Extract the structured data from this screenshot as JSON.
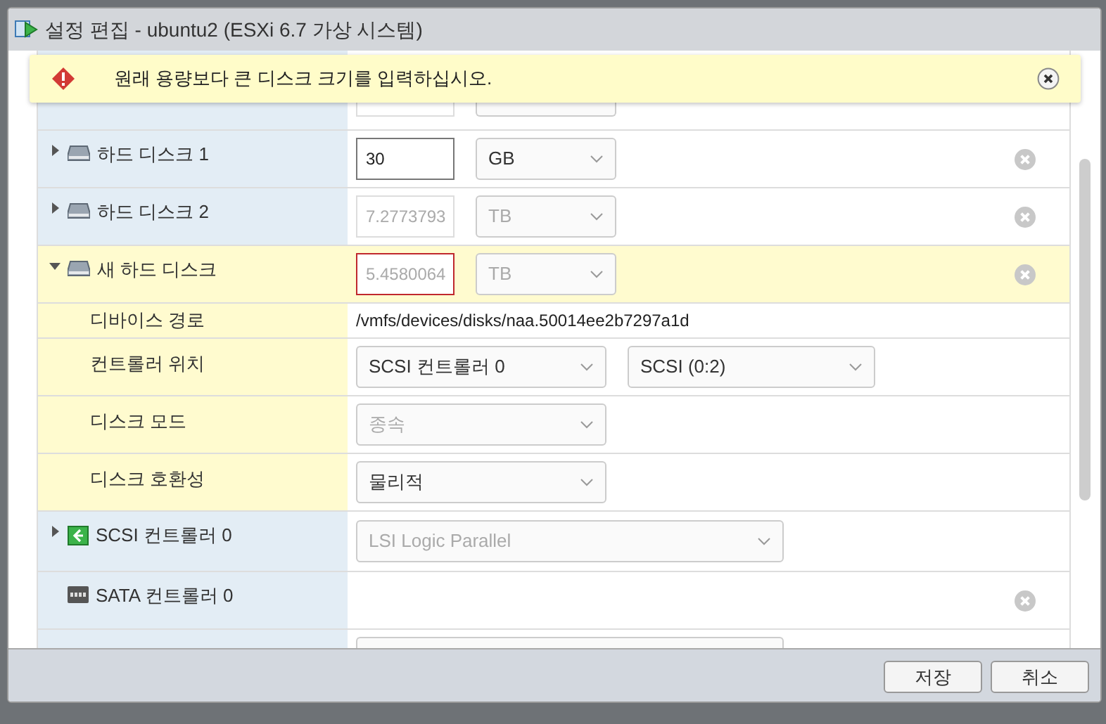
{
  "window": {
    "title": "설정 편집 - ubuntu2 (ESXi 6.7 가상 시스템)"
  },
  "alert": {
    "message": "원래 용량보다 큰 디스크 크기를 입력하십시오."
  },
  "devices": [
    {
      "kind": "disk",
      "label": "하드 디스크 1",
      "expanded": false,
      "selected": false,
      "removable": true,
      "size": {
        "value": "30",
        "disabled": false,
        "error": false
      },
      "unit": {
        "value": "GB",
        "disabled": false
      }
    },
    {
      "kind": "disk",
      "label": "하드 디스크 2",
      "expanded": false,
      "selected": false,
      "removable": true,
      "size": {
        "value": "7.2773793",
        "disabled": true,
        "error": false
      },
      "unit": {
        "value": "TB",
        "disabled": true
      }
    },
    {
      "kind": "disk",
      "label": "새 하드 디스크",
      "expanded": true,
      "selected": true,
      "removable": true,
      "size": {
        "value": "5.4580064",
        "disabled": true,
        "error": true
      },
      "unit": {
        "value": "TB",
        "disabled": true
      },
      "children": [
        {
          "kind": "text",
          "label": "디바이스 경로",
          "value": "/vmfs/devices/disks/naa.50014ee2b7297a1d"
        },
        {
          "kind": "selects",
          "label": "컨트롤러 위치",
          "selects": [
            {
              "value": "SCSI 컨트롤러 0",
              "disabled": false
            },
            {
              "value": "SCSI (0:2)",
              "disabled": false
            }
          ]
        },
        {
          "kind": "selects",
          "label": "디스크 모드",
          "selects": [
            {
              "value": "종속",
              "disabled": true
            }
          ]
        },
        {
          "kind": "selects",
          "label": "디스크 호환성",
          "selects": [
            {
              "value": "물리적",
              "disabled": false
            }
          ]
        }
      ]
    },
    {
      "kind": "scsi",
      "label": "SCSI 컨트롤러 0",
      "expanded": false,
      "removable": false,
      "select": {
        "value": "LSI Logic Parallel",
        "disabled": true
      }
    },
    {
      "kind": "sata",
      "label": "SATA 컨트롤러 0",
      "removable": true
    }
  ],
  "buttons": [
    {
      "label": "저장"
    },
    {
      "label": "취소"
    }
  ]
}
